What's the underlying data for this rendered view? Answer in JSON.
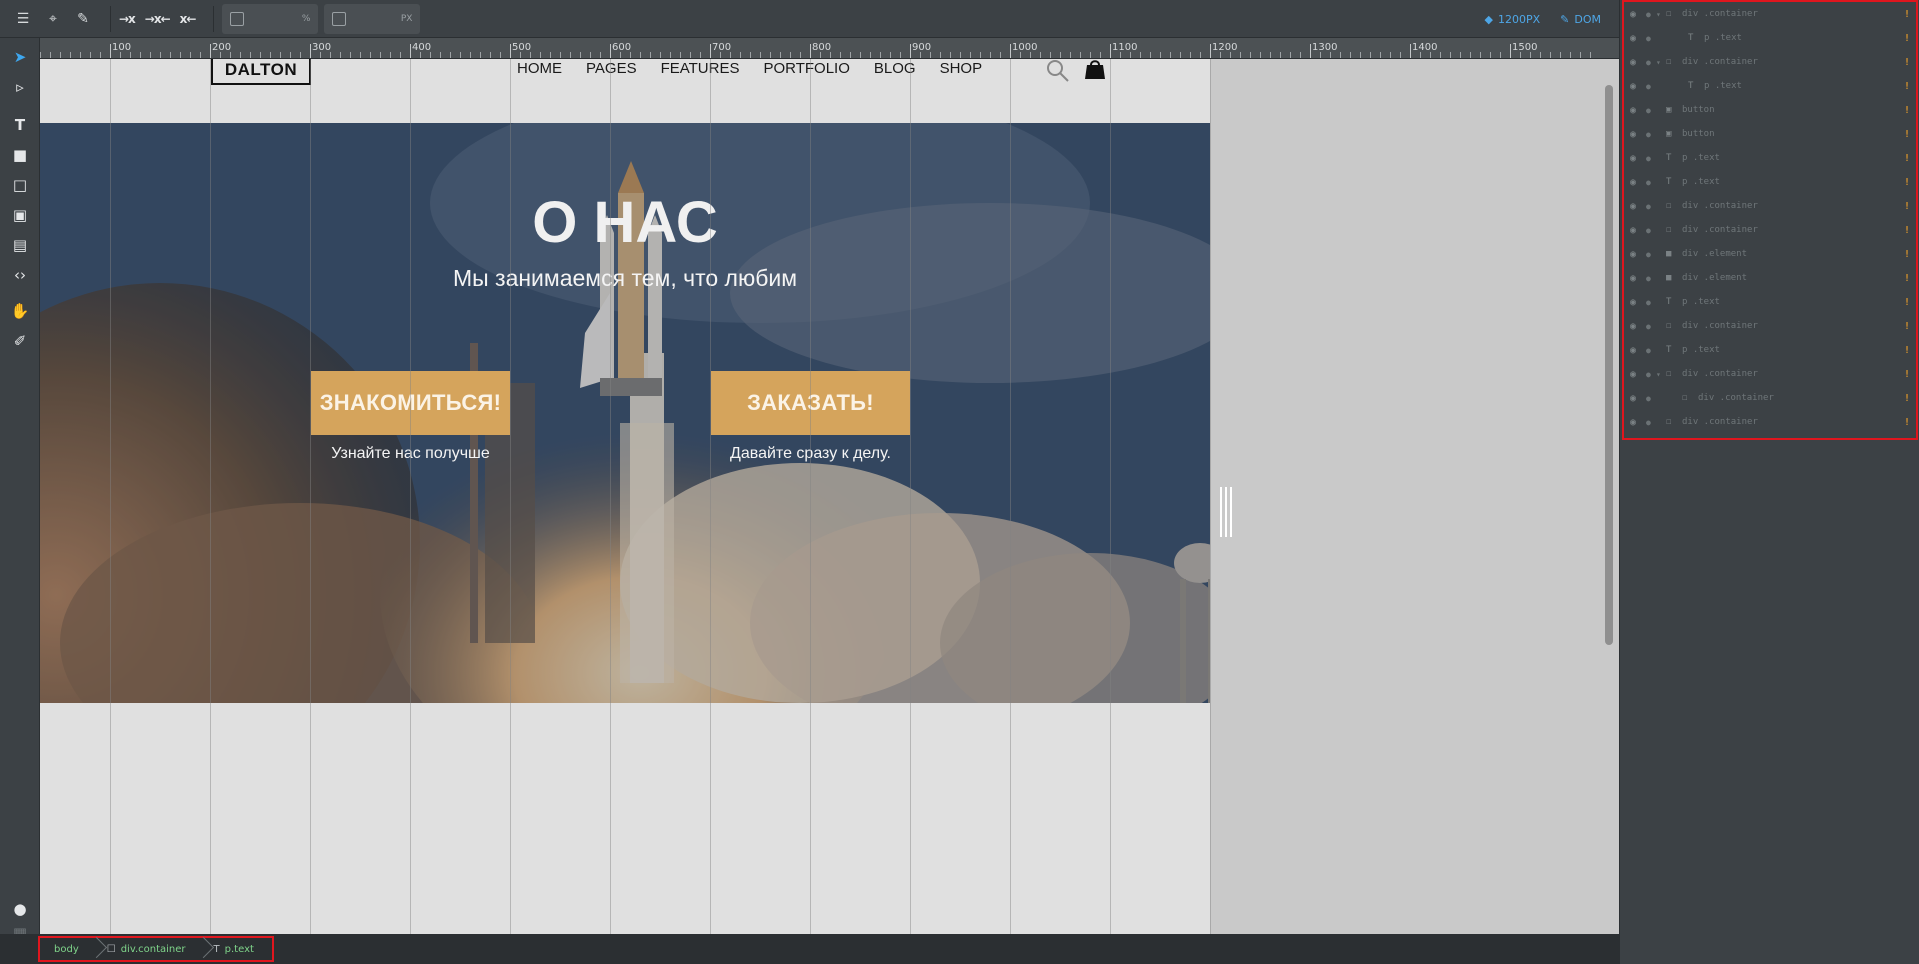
{
  "toolbar": {
    "width_unit": "%",
    "height_unit": "PX",
    "breakpoint_label": "1200PX",
    "dom_label": "DOM",
    "icons": [
      "menu-icon",
      "target-icon",
      "pin-icon",
      "align-arrow-icon",
      "align-both-icon",
      "align-clear-icon"
    ],
    "accent": "#4ea6e6"
  },
  "ruler": {
    "labels": [
      "100",
      "200",
      "300",
      "400",
      "500",
      "600",
      "700",
      "800",
      "900",
      "1000",
      "1100",
      "1200",
      "1300",
      "1400",
      "1500"
    ]
  },
  "site": {
    "logo": "DALTON",
    "nav": [
      "HOME",
      "PAGES",
      "FEATURES",
      "PORTFOLIO",
      "BLOG",
      "SHOP"
    ],
    "hero_title": "О НАС",
    "hero_subtitle": "Мы занимаемся тем, что любим",
    "button_left": "ЗНАКОМИТЬСЯ!",
    "caption_left": "Узнайте нас получше",
    "button_right": "ЗАКАЗАТЬ!",
    "caption_right": "Давайте сразу к делу.",
    "button_color": "#d5a45c"
  },
  "breadcrumb": {
    "items": [
      "body",
      "div.container",
      "p.text"
    ]
  },
  "layers": {
    "rows": [
      {
        "label": "div .container",
        "kind": "container",
        "expanded": true
      },
      {
        "label": "p .text",
        "kind": "text"
      },
      {
        "label": "div .container",
        "kind": "container",
        "expanded": true
      },
      {
        "label": "p .text",
        "kind": "text"
      },
      {
        "label": "button",
        "kind": "button"
      },
      {
        "label": "button",
        "kind": "button"
      },
      {
        "label": "p .text",
        "kind": "text"
      },
      {
        "label": "p .text",
        "kind": "text"
      },
      {
        "label": "div .container",
        "kind": "container"
      },
      {
        "label": "div .container",
        "kind": "container"
      },
      {
        "label": "div .element",
        "kind": "element"
      },
      {
        "label": "div .element",
        "kind": "element"
      },
      {
        "label": "p .text",
        "kind": "text"
      },
      {
        "label": "div .container",
        "kind": "container"
      },
      {
        "label": "p .text",
        "kind": "text"
      },
      {
        "label": "div .container",
        "kind": "container",
        "expanded": true
      },
      {
        "label": "div .container",
        "kind": "container"
      },
      {
        "label": "div .container",
        "kind": "container"
      }
    ]
  }
}
